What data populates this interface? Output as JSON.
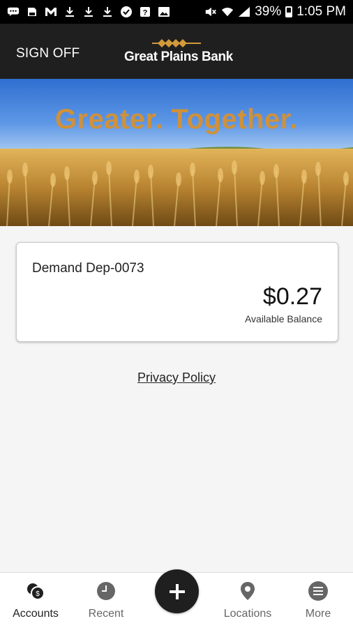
{
  "status_bar": {
    "battery": "39%",
    "time": "1:05 PM"
  },
  "header": {
    "sign_off": "SIGN OFF",
    "logo_text": "Great Plains Bank"
  },
  "banner": {
    "tagline": "Greater. Together."
  },
  "account": {
    "name": "Demand Dep-0073",
    "balance": "$0.27",
    "balance_label": "Available Balance"
  },
  "privacy_link": "Privacy Policy",
  "bottom_nav": {
    "accounts": "Accounts",
    "recent": "Recent",
    "locations": "Locations",
    "more": "More"
  },
  "colors": {
    "header_bg": "#1f1f1f",
    "tagline": "#d0913a",
    "logo_accent": "#d39a3a",
    "nav_icon": "#666666"
  }
}
